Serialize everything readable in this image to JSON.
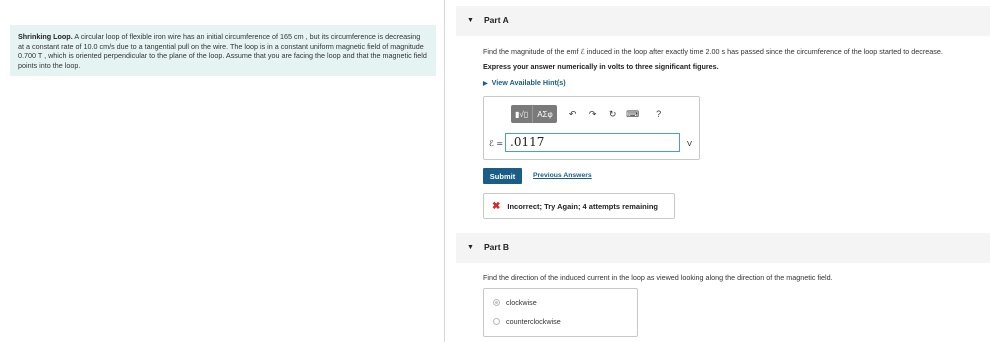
{
  "problem": {
    "title": "Shrinking Loop.",
    "text": "A circular loop of flexible iron wire has an initial circumference of 165 cm , but its circumference is decreasing at a constant rate of 10.0 cm/s due to a tangential pull on the wire. The loop is in a constant uniform magnetic field of magnitude 0.700 T , which is oriented perpendicular to the plane of the loop. Assume that you are facing the loop and that the magnetic field points into the loop."
  },
  "part_a": {
    "title": "Part A",
    "question": "Find the magnitude of the emf ℰ induced in the loop after exactly time 2.00 s has passed since the circumference of the loop started to decrease.",
    "instruction": "Express your answer numerically in volts to three significant figures.",
    "hint_label": "View Available Hint(s)",
    "toolbar": {
      "templates_label": "▮√▯",
      "greek_label": "ΑΣφ",
      "undo_icon": "↶",
      "redo_icon": "↷",
      "reset_icon": "↻",
      "keyboard_icon": "⌨",
      "help_icon": "?"
    },
    "input_label": "ℰ =",
    "input_value": ".0117",
    "unit": "V",
    "submit_label": "Submit",
    "previous_answers_label": "Previous Answers",
    "feedback": {
      "icon": "✖",
      "message": "Incorrect; Try Again; 4 attempts remaining",
      "color": "#d42a2a"
    }
  },
  "part_b": {
    "title": "Part B",
    "question": "Find the direction of the induced current in the loop as viewed looking along the direction of the magnetic field.",
    "options": [
      "clockwise",
      "counterclockwise"
    ],
    "selected": "clockwise"
  },
  "colors": {
    "accent": "#1a5e87",
    "problem_bg": "#e6f3f3",
    "input_border": "#4a9fd0",
    "error": "#d42a2a"
  }
}
